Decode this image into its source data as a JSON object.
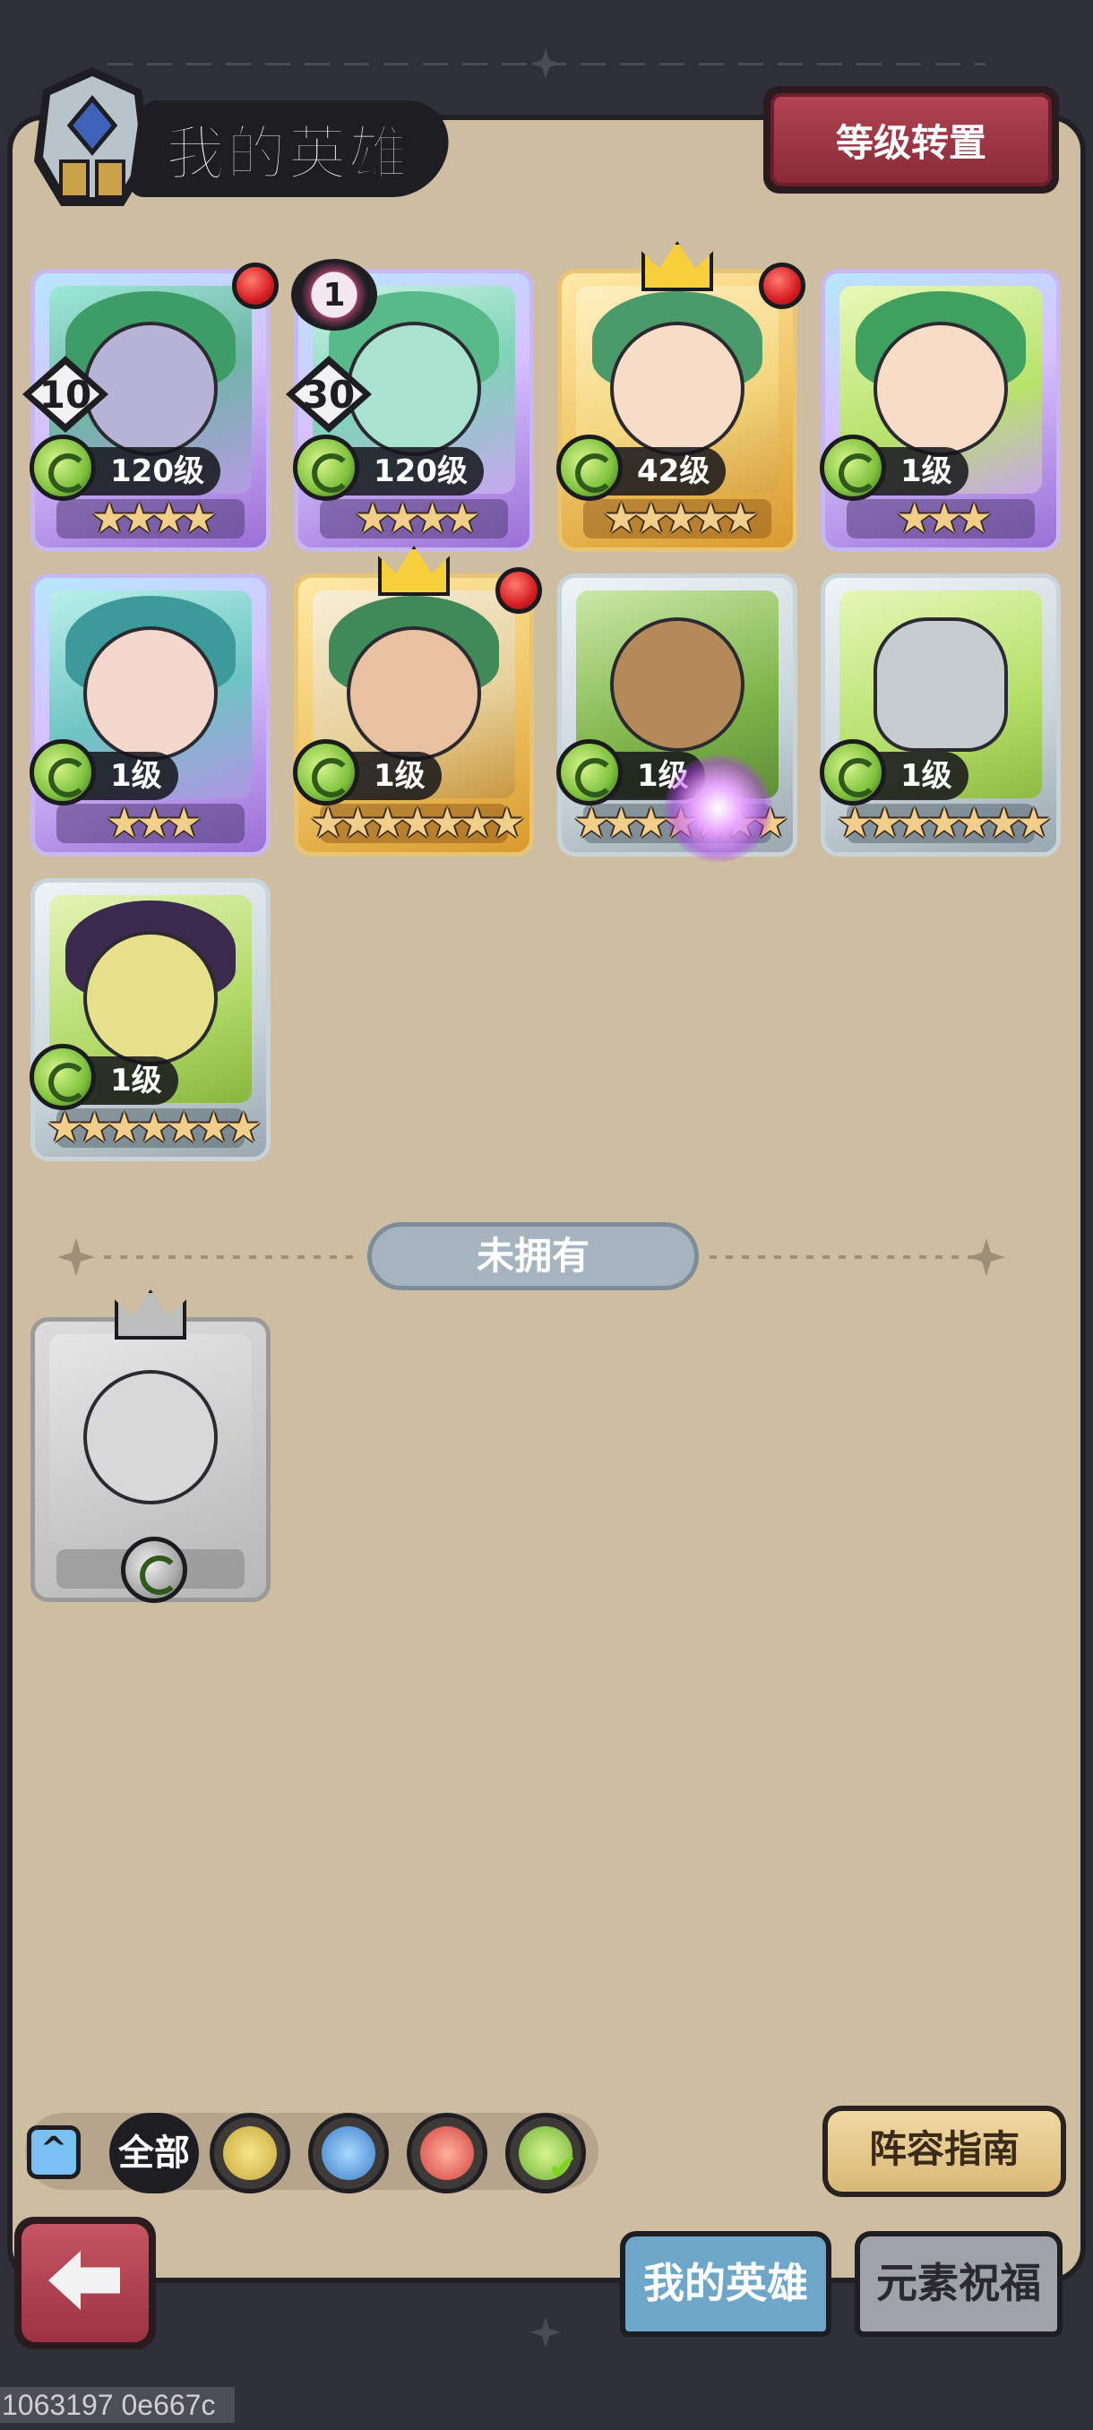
{
  "header": {
    "title": "我的英雄",
    "level_transfer_button": "等级转置"
  },
  "heroes": [
    {
      "level": "120级",
      "stars": "★★★★",
      "frame": "purple",
      "badge_number": "10",
      "red_dot": true
    },
    {
      "level": "120级",
      "stars": "★★★★",
      "frame": "purple",
      "badge_number": "30",
      "rank": "1"
    },
    {
      "level": "42级",
      "stars": "★★★★★",
      "frame": "gold",
      "crown": true,
      "red_dot": true
    },
    {
      "level": "1级",
      "stars": "★★★",
      "frame": "purple"
    },
    {
      "level": "1级",
      "stars": "★★★",
      "frame": "purple"
    },
    {
      "level": "1级",
      "stars": "★★★★★★★",
      "frame": "gold",
      "crown": true,
      "red_dot": true
    },
    {
      "level": "1级",
      "stars": "★★★★★★★",
      "frame": "grey"
    },
    {
      "level": "1级",
      "stars": "★★★★★★★",
      "frame": "grey"
    },
    {
      "level": "1级",
      "stars": "★★★★★★★",
      "frame": "grey"
    }
  ],
  "unowned_section": {
    "label": "未拥有"
  },
  "filters": {
    "toggle_icon": "^",
    "all_label": "全部",
    "elements": [
      "earth-element-icon",
      "water-element-icon",
      "fire-element-icon",
      "wind-element-icon"
    ],
    "selected": "wind-element-icon"
  },
  "guide_button": "阵容指南",
  "tabs": {
    "my_heroes": "我的英雄",
    "element_blessing": "元素祝福"
  },
  "watermark": "1063197 0e667c",
  "colors": {
    "panel": "#cdbda1",
    "accent_red": "#b04452",
    "tab_active": "#6ea6c9"
  }
}
